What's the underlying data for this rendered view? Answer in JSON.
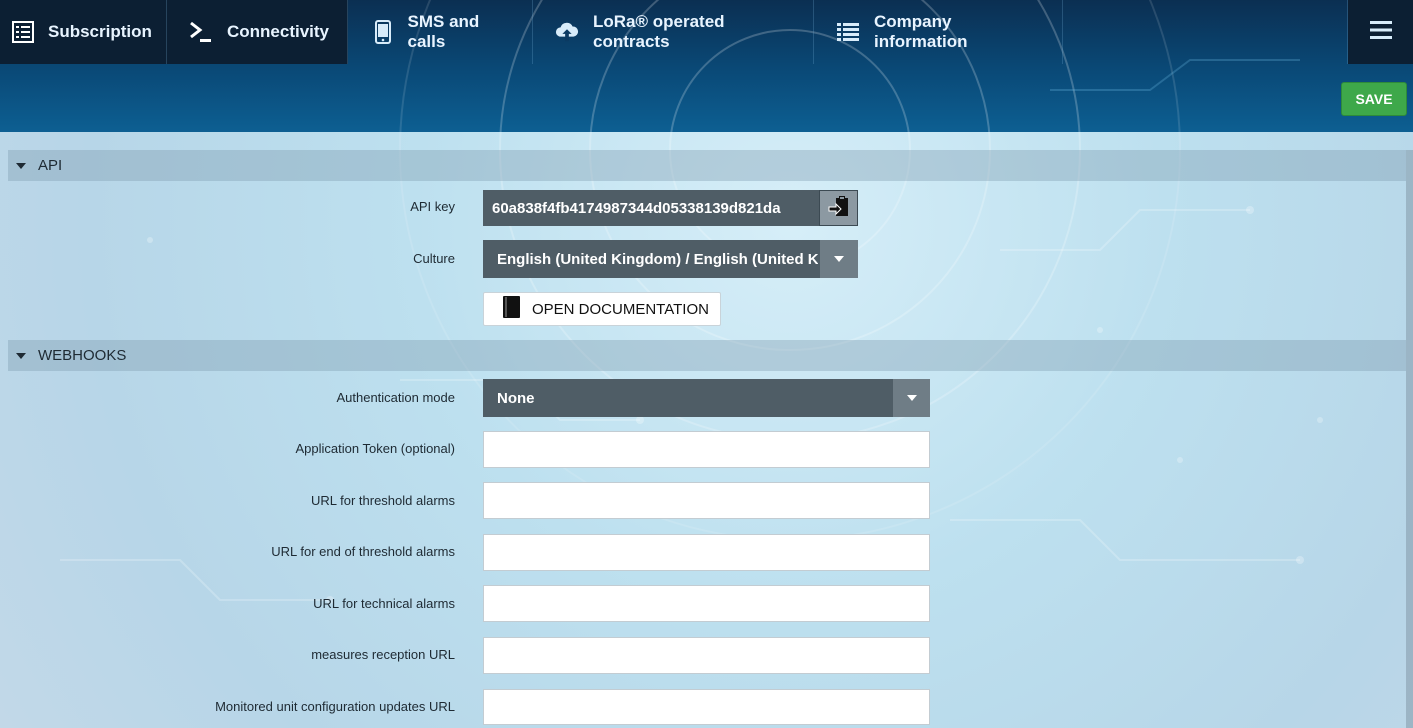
{
  "nav": {
    "tabs": [
      {
        "label": "Subscription",
        "icon": "list-document-icon"
      },
      {
        "label": "Connectivity",
        "icon": "terminal-icon"
      },
      {
        "label": "SMS and calls",
        "icon": "mobile-phone-icon"
      },
      {
        "label": "LoRa® operated contracts",
        "icon": "cloud-upload-icon"
      },
      {
        "label": "Company information",
        "icon": "list-icon"
      }
    ],
    "menu_icon": "hamburger-menu-icon"
  },
  "toolbar": {
    "save_label": "SAVE"
  },
  "api": {
    "section_title": "API",
    "api_key_label": "API key",
    "api_key_value": "60a838f4fb4174987344d05338139d821da",
    "copy_icon": "clipboard-paste-icon",
    "culture_label": "Culture",
    "culture_value": "English (United Kingdom) / English (United K...",
    "doc_button_label": "OPEN DOCUMENTATION",
    "doc_icon": "book-icon"
  },
  "webhooks": {
    "section_title": "WEBHOOKS",
    "auth_mode_label": "Authentication mode",
    "auth_mode_value": "None",
    "fields": [
      {
        "label": "Application Token (optional)",
        "value": ""
      },
      {
        "label": "URL for threshold alarms",
        "value": ""
      },
      {
        "label": "URL for end of threshold alarms",
        "value": ""
      },
      {
        "label": "URL for technical alarms",
        "value": ""
      },
      {
        "label": "measures reception URL",
        "value": ""
      },
      {
        "label": "Monitored unit configuration updates URL",
        "value": ""
      }
    ]
  },
  "colors": {
    "header_dark": "#0c1f33",
    "save_green": "#3ea84a",
    "field_dark": "#4f5d66",
    "addon_gray": "#8c99a2"
  }
}
